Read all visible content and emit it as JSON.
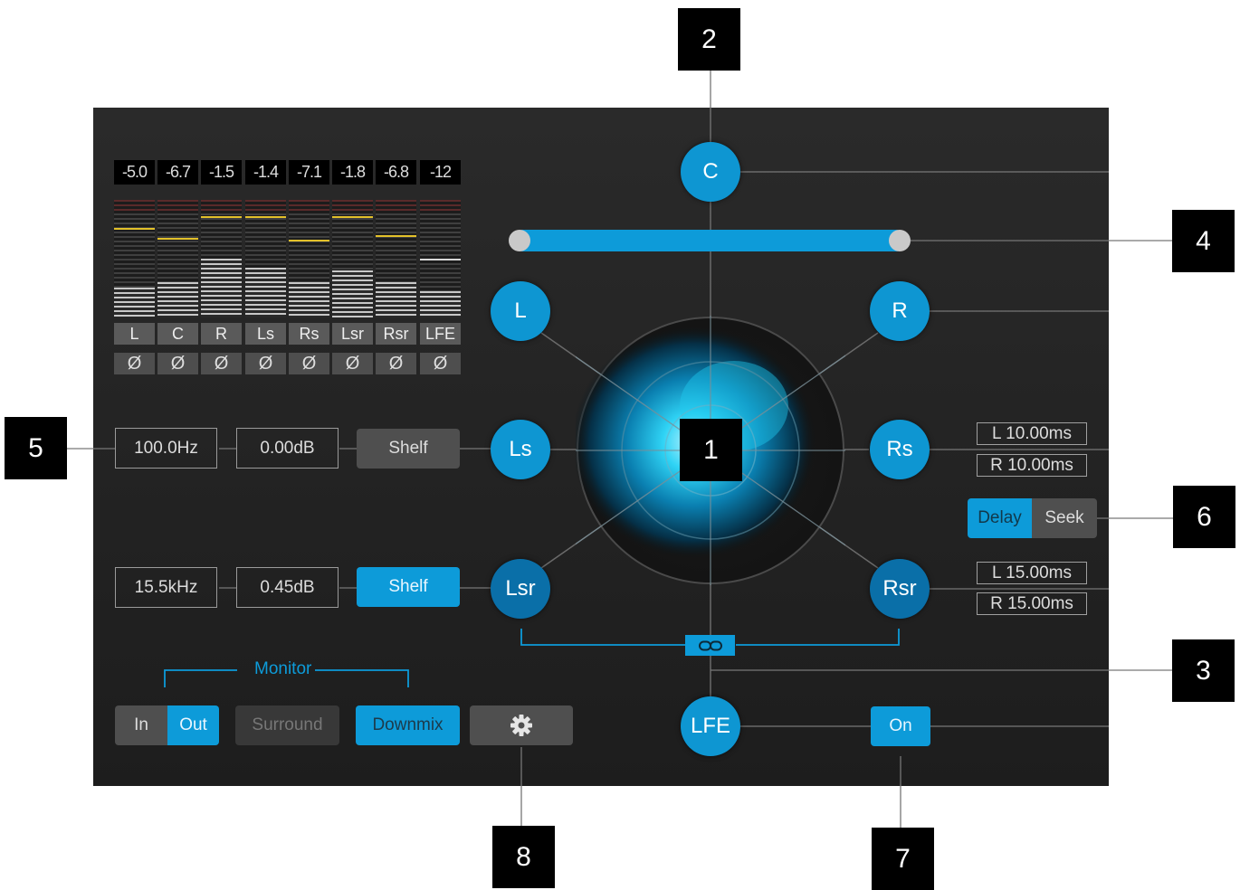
{
  "meters": {
    "readouts": [
      "-5.0",
      "-6.7",
      "-1.5",
      "-1.4",
      "-7.1",
      "-1.8",
      "-6.8",
      "-12"
    ],
    "channels": [
      "L",
      "C",
      "R",
      "Ls",
      "Rs",
      "Lsr",
      "Rsr",
      "LFE"
    ],
    "phase_symbol": "Ø",
    "peak_levels": [
      0.76,
      0.68,
      0.86,
      0.86,
      0.66,
      0.86,
      0.7,
      0.5
    ],
    "fill_levels": [
      0.25,
      0.3,
      0.5,
      0.42,
      0.3,
      0.4,
      0.3,
      0.22
    ]
  },
  "eq": {
    "low": {
      "freq": "100.0Hz",
      "gain": "0.00dB",
      "shelf_label": "Shelf",
      "shelf_active": false
    },
    "high": {
      "freq": "15.5kHz",
      "gain": "0.45dB",
      "shelf_label": "Shelf",
      "shelf_active": true
    }
  },
  "monitor": {
    "label": "Monitor",
    "in_label": "In",
    "out_label": "Out",
    "surround_label": "Surround",
    "downmix_label": "Downmix",
    "settings_icon": "gear-icon"
  },
  "speakers": {
    "C": "C",
    "L": "L",
    "R": "R",
    "Ls": "Ls",
    "Rs": "Rs",
    "Lsr": "Lsr",
    "Rsr": "Rsr",
    "LFE": "LFE"
  },
  "link_icon": "link-icon",
  "delays": {
    "rs_left": "L 10.00ms",
    "rs_right": "R 10.00ms",
    "rsr_left": "L 15.00ms",
    "rsr_right": "R 15.00ms",
    "delay_label": "Delay",
    "seek_label": "Seek"
  },
  "lfe_toggle": "On",
  "callouts": [
    "1",
    "2",
    "3",
    "4",
    "5",
    "6",
    "7",
    "8"
  ],
  "colors": {
    "accent": "#0d9bd9",
    "panel": "#232323",
    "peak": "#e3c12a",
    "callout_bg": "#000000"
  }
}
